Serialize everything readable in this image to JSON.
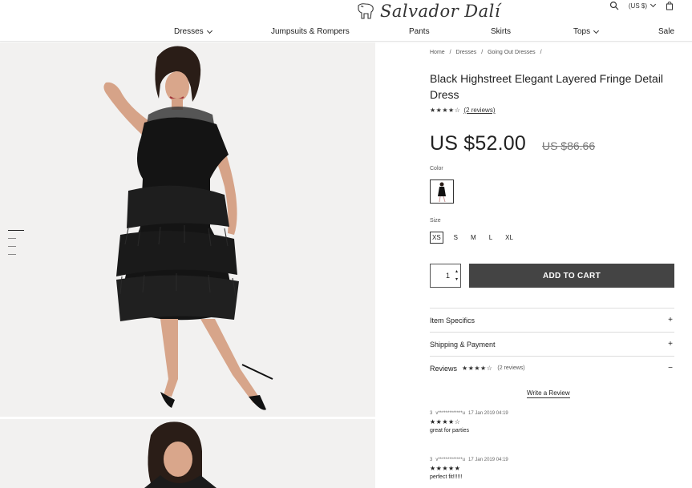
{
  "header": {
    "brand": "Salvador Dalí",
    "currency": "(US $)",
    "nav": [
      "Dresses",
      "Jumpsuits & Rompers",
      "Pants",
      "Skirts",
      "Tops",
      "Sale"
    ]
  },
  "product": {
    "breadcrumb": [
      "Home",
      "/",
      "Dresses",
      "/",
      "Going Out Dresses",
      "/"
    ],
    "title": "Black Highstreet Elegant Layered Fringe Detail Dress",
    "rating": 4.5,
    "rating_stars": "★★★★☆",
    "review_link": "(2 reviews)",
    "price": "US $52.00",
    "old_price": "US $86.66",
    "color_label": "Color",
    "size_label": "Size",
    "sizes": [
      "XS",
      "S",
      "M",
      "L",
      "XL"
    ],
    "selected_size": "XS",
    "quantity": "1",
    "add_to_cart": "ADD TO CART"
  },
  "accordion": {
    "item_specifics": "Item Specifics",
    "shipping": "Shipping & Payment",
    "reviews": "Reviews",
    "reviews_stars": "★★★★☆",
    "reviews_count": "(2 reviews)",
    "plus": "+",
    "minus": "−"
  },
  "reviews": {
    "write_label": "Write a Review",
    "items": [
      {
        "num": "3",
        "user": "v*************u",
        "date": "17 Jan 2019 04:19",
        "stars": "★★★★☆",
        "text": "great for parties"
      },
      {
        "num": "3",
        "user": "v*************u",
        "date": "17 Jan 2019 04:19",
        "stars": "★★★★★",
        "text": "perfect fit!!!!!!"
      }
    ]
  },
  "icons": {
    "search": "search-icon",
    "cart": "bag-icon",
    "logo": "elephant-logo-icon"
  }
}
